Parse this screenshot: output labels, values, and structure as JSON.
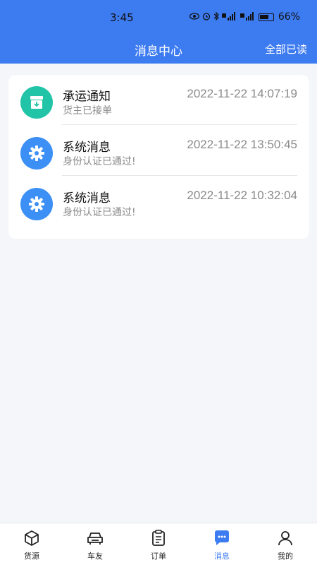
{
  "status_bar": {
    "time": "3:45",
    "battery": "66%"
  },
  "header": {
    "title": "消息中心",
    "mark_all_read": "全部已读"
  },
  "messages": [
    {
      "title": "承运通知",
      "subtitle": "货主已接单",
      "time": "2022-11-22 14:07:19",
      "icon": "archive-icon",
      "color": "#21c4a6"
    },
    {
      "title": "系统消息",
      "subtitle": "身份认证已通过!",
      "time": "2022-11-22 13:50:45",
      "icon": "gear-icon",
      "color": "#3b8ff5"
    },
    {
      "title": "系统消息",
      "subtitle": "身份认证已通过!",
      "time": "2022-11-22 10:32:04",
      "icon": "gear-icon",
      "color": "#3b8ff5"
    }
  ],
  "tabs": [
    {
      "label": "货源",
      "icon": "cube-icon",
      "active": false
    },
    {
      "label": "车友",
      "icon": "car-icon",
      "active": false
    },
    {
      "label": "订单",
      "icon": "clipboard-icon",
      "active": false
    },
    {
      "label": "消息",
      "icon": "chat-icon",
      "active": true
    },
    {
      "label": "我的",
      "icon": "user-icon",
      "active": false
    }
  ],
  "colors": {
    "primary": "#3d7bf0",
    "background": "#f4f6fa"
  }
}
